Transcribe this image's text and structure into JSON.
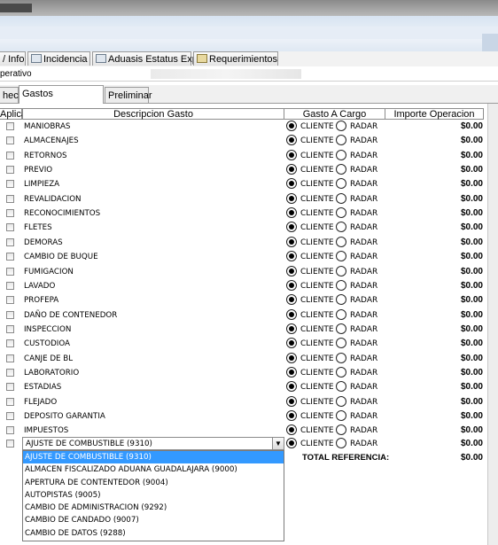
{
  "tabs_top": [
    {
      "label": "/ Info",
      "icon": ""
    },
    {
      "label": "Incidencia",
      "icon": "incidencia-icon"
    },
    {
      "label": "Aduasis Estatus Exp",
      "icon": "grid-icon"
    },
    {
      "label": "Requerimientos",
      "icon": "folder-icon"
    }
  ],
  "operativo_label": "perativo",
  "tabs_sub": [
    "heck",
    "Gastos Relacionados",
    "Preliminar"
  ],
  "headers": {
    "aplica": "Aplica",
    "descripcion": "Descripcion Gasto",
    "cargo": "Gasto A Cargo",
    "importe": "Importe Operacion"
  },
  "radio_labels": {
    "cliente": "CLIENTE",
    "radar": "RADAR"
  },
  "rows": [
    {
      "descripcion": "MANIOBRAS",
      "cargo": "CLIENTE",
      "importe": "$0.00"
    },
    {
      "descripcion": "ALMACENAJES",
      "cargo": "CLIENTE",
      "importe": "$0.00"
    },
    {
      "descripcion": "RETORNOS",
      "cargo": "CLIENTE",
      "importe": "$0.00"
    },
    {
      "descripcion": "PREVIO",
      "cargo": "CLIENTE",
      "importe": "$0.00"
    },
    {
      "descripcion": "LIMPIEZA",
      "cargo": "CLIENTE",
      "importe": "$0.00"
    },
    {
      "descripcion": "REVALIDACION",
      "cargo": "CLIENTE",
      "importe": "$0.00"
    },
    {
      "descripcion": "RECONOCIMIENTOS",
      "cargo": "CLIENTE",
      "importe": "$0.00"
    },
    {
      "descripcion": "FLETES",
      "cargo": "CLIENTE",
      "importe": "$0.00"
    },
    {
      "descripcion": "DEMORAS",
      "cargo": "CLIENTE",
      "importe": "$0.00"
    },
    {
      "descripcion": "CAMBIO DE BUQUE",
      "cargo": "CLIENTE",
      "importe": "$0.00"
    },
    {
      "descripcion": "FUMIGACION",
      "cargo": "CLIENTE",
      "importe": "$0.00"
    },
    {
      "descripcion": "LAVADO",
      "cargo": "CLIENTE",
      "importe": "$0.00"
    },
    {
      "descripcion": "PROFEPA",
      "cargo": "CLIENTE",
      "importe": "$0.00"
    },
    {
      "descripcion": "DAÑO DE CONTENEDOR",
      "cargo": "CLIENTE",
      "importe": "$0.00"
    },
    {
      "descripcion": "INSPECCION",
      "cargo": "CLIENTE",
      "importe": "$0.00"
    },
    {
      "descripcion": "CUSTODIOA",
      "cargo": "CLIENTE",
      "importe": "$0.00"
    },
    {
      "descripcion": "CANJE DE BL",
      "cargo": "CLIENTE",
      "importe": "$0.00"
    },
    {
      "descripcion": "LABORATORIO",
      "cargo": "CLIENTE",
      "importe": "$0.00"
    },
    {
      "descripcion": "ESTADIAS",
      "cargo": "CLIENTE",
      "importe": "$0.00"
    },
    {
      "descripcion": "FLEJADO",
      "cargo": "CLIENTE",
      "importe": "$0.00"
    },
    {
      "descripcion": "DEPOSITO GARANTIA",
      "cargo": "CLIENTE",
      "importe": "$0.00"
    },
    {
      "descripcion": "IMPUESTOS",
      "cargo": "CLIENTE",
      "importe": "$0.00"
    }
  ],
  "combo_row": {
    "selected": "AJUSTE DE COMBUSTIBLE (9310)",
    "cargo": "CLIENTE",
    "importe": "$0.00"
  },
  "dropdown_options": [
    "AJUSTE DE COMBUSTIBLE (9310)",
    "ALMACEN FISCALIZADO ADUANA GUADALAJARA (9000)",
    "APERTURA DE CONTENTEDOR (9004)",
    "AUTOPISTAS (9005)",
    "CAMBIO DE ADMINISTRACION (9292)",
    "CAMBIO DE CANDADO (9007)",
    "CAMBIO DE DATOS (9288)"
  ],
  "total": {
    "label": "TOTAL REFERENCIA:",
    "value": "$0.00"
  }
}
